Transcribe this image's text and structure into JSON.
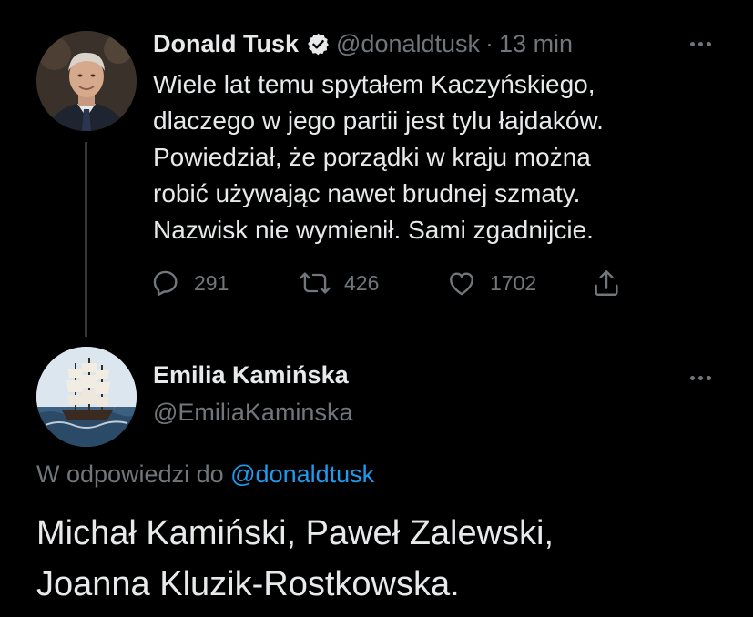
{
  "colors": {
    "background": "#000000",
    "text_primary": "#e7e9ea",
    "text_secondary": "#71767b",
    "accent": "#1d9bf0",
    "thread_line": "#333639"
  },
  "tweet": {
    "author": {
      "display_name": "Donald Tusk",
      "verified": true,
      "verified_icon": "verified-badge-icon",
      "handle": "@donaldtusk",
      "separator": "·",
      "time": "13 min",
      "avatar_icon": "avatar-photo-icon"
    },
    "more_icon": "more-options-icon",
    "text_lines": [
      "Wiele lat temu spytałem Kaczyńskiego,",
      "dlaczego w jego partii jest tylu łajdaków.",
      "Powiedział, że porządki w kraju można",
      "robić używając nawet brudnej szmaty.",
      "Nazwisk nie wymienił. Sami zgadnijcie."
    ],
    "actions": {
      "reply": {
        "icon": "reply-icon",
        "count": "291"
      },
      "retweet": {
        "icon": "retweet-icon",
        "count": "426"
      },
      "like": {
        "icon": "heart-icon",
        "count": "1702"
      },
      "share": {
        "icon": "share-icon"
      }
    }
  },
  "reply": {
    "author": {
      "display_name": "Emilia Kamińska",
      "handle": "@EmiliaKaminska",
      "avatar_icon": "sailing-ship-avatar-icon"
    },
    "more_icon": "more-options-icon",
    "replying_to_prefix": "W odpowiedzi do",
    "replying_to_mention": "@donaldtusk",
    "text_lines": [
      "Michał Kamiński, Paweł Zalewski,",
      "Joanna Kluzik-Rostkowska."
    ]
  }
}
